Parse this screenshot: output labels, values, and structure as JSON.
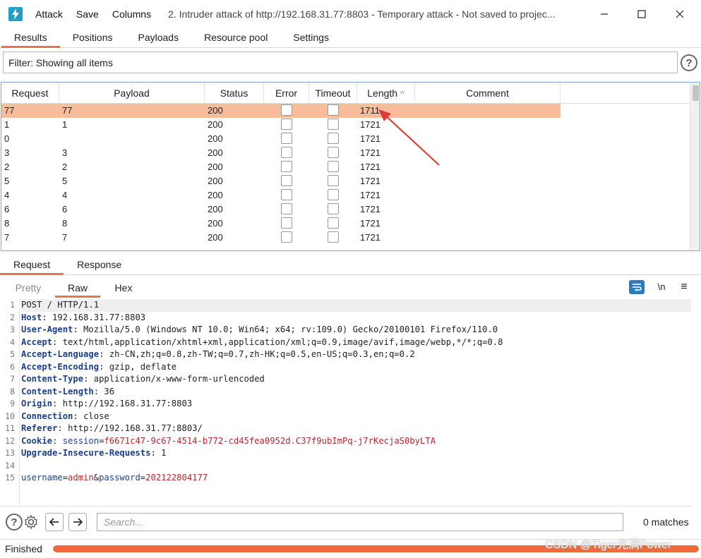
{
  "window": {
    "menu": [
      "Attack",
      "Save",
      "Columns"
    ],
    "title": "2. Intruder attack of http://192.168.31.77:8803 - Temporary attack - Not saved to projec...",
    "controls": {
      "minimize": "minimize-icon",
      "maximize": "maximize-icon",
      "close": "close-icon"
    }
  },
  "main_tabs": [
    {
      "label": "Results",
      "active": true
    },
    {
      "label": "Positions",
      "active": false
    },
    {
      "label": "Payloads",
      "active": false
    },
    {
      "label": "Resource pool",
      "active": false
    },
    {
      "label": "Settings",
      "active": false
    }
  ],
  "filter": {
    "label": "Filter: Showing all items"
  },
  "table": {
    "columns": [
      "Request",
      "Payload",
      "Status",
      "Error",
      "Timeout",
      "Length",
      "Comment"
    ],
    "sort": {
      "column": "Length",
      "direction": "ascending"
    },
    "rows": [
      {
        "request": "77",
        "payload": "77",
        "status": "200",
        "error": false,
        "timeout": false,
        "length": "1711",
        "comment": "",
        "selected": true
      },
      {
        "request": "1",
        "payload": "1",
        "status": "200",
        "error": false,
        "timeout": false,
        "length": "1721",
        "comment": ""
      },
      {
        "request": "0",
        "payload": "",
        "status": "200",
        "error": false,
        "timeout": false,
        "length": "1721",
        "comment": ""
      },
      {
        "request": "3",
        "payload": "3",
        "status": "200",
        "error": false,
        "timeout": false,
        "length": "1721",
        "comment": ""
      },
      {
        "request": "2",
        "payload": "2",
        "status": "200",
        "error": false,
        "timeout": false,
        "length": "1721",
        "comment": ""
      },
      {
        "request": "5",
        "payload": "5",
        "status": "200",
        "error": false,
        "timeout": false,
        "length": "1721",
        "comment": ""
      },
      {
        "request": "4",
        "payload": "4",
        "status": "200",
        "error": false,
        "timeout": false,
        "length": "1721",
        "comment": ""
      },
      {
        "request": "6",
        "payload": "6",
        "status": "200",
        "error": false,
        "timeout": false,
        "length": "1721",
        "comment": ""
      },
      {
        "request": "8",
        "payload": "8",
        "status": "200",
        "error": false,
        "timeout": false,
        "length": "1721",
        "comment": ""
      },
      {
        "request": "7",
        "payload": "7",
        "status": "200",
        "error": false,
        "timeout": false,
        "length": "1721",
        "comment": ""
      }
    ]
  },
  "rr_tabs": [
    {
      "label": "Request",
      "active": true
    },
    {
      "label": "Response",
      "active": false
    }
  ],
  "editor_tabs": [
    {
      "label": "Pretty",
      "active": false
    },
    {
      "label": "Raw",
      "active": true
    },
    {
      "label": "Hex",
      "active": false
    }
  ],
  "editor_tools": {
    "wrap": "wrap-lines-icon",
    "newline": "\\n",
    "menu": "hamburger-menu-icon"
  },
  "request_lines": [
    {
      "n": "1",
      "key": "",
      "sep": "",
      "value": "POST / HTTP/1.1"
    },
    {
      "n": "2",
      "key": "Host",
      "sep": ": ",
      "value": "192.168.31.77:8803"
    },
    {
      "n": "3",
      "key": "User-Agent",
      "sep": ": ",
      "value": "Mozilla/5.0 (Windows NT 10.0; Win64; x64; rv:109.0) Gecko/20100101 Firefox/110.0"
    },
    {
      "n": "4",
      "key": "Accept",
      "sep": ": ",
      "value": "text/html,application/xhtml+xml,application/xml;q=0.9,image/avif,image/webp,*/*;q=0.8"
    },
    {
      "n": "5",
      "key": "Accept-Language",
      "sep": ": ",
      "value": "zh-CN,zh;q=0.8,zh-TW;q=0.7,zh-HK;q=0.5,en-US;q=0.3,en;q=0.2"
    },
    {
      "n": "6",
      "key": "Accept-Encoding",
      "sep": ": ",
      "value": "gzip, deflate"
    },
    {
      "n": "7",
      "key": "Content-Type",
      "sep": ": ",
      "value": "application/x-www-form-urlencoded"
    },
    {
      "n": "8",
      "key": "Content-Length",
      "sep": ": ",
      "value": "36"
    },
    {
      "n": "9",
      "key": "Origin",
      "sep": ": ",
      "value": "http://192.168.31.77:8803"
    },
    {
      "n": "10",
      "key": "Connection",
      "sep": ": ",
      "value": "close"
    },
    {
      "n": "11",
      "key": "Referer",
      "sep": ": ",
      "value": "http://192.168.31.77:8803/"
    },
    {
      "n": "12",
      "key": "Cookie",
      "sep": ": ",
      "cookie_name": "session",
      "cookie_value": "f6671c47-9c67-4514-b772-cd45fea0952d.C37f9ubImPq-j7rKecjaS0byLTA"
    },
    {
      "n": "13",
      "key": "Upgrade-Insecure-Requests",
      "sep": ": ",
      "value": "1"
    },
    {
      "n": "14",
      "key": "",
      "sep": "",
      "value": ""
    },
    {
      "n": "15",
      "body": [
        {
          "name": "username",
          "value": "admin"
        },
        {
          "name": "password",
          "value": "202122804177"
        }
      ]
    }
  ],
  "search": {
    "placeholder": "Search...",
    "value": "",
    "matches": "0 matches"
  },
  "status": {
    "text": "Finished",
    "progress": 1.0
  },
  "watermark": "CSDN @Tiger充满Power",
  "colors": {
    "accent": "#e8744e",
    "selected_row": "#f9bc9a",
    "progress": "#f06b3a",
    "logo": "#1ea0c8",
    "header_key": "#1a3f8f",
    "value_red": "#b3282c",
    "annotation_arrow": "#e23a34"
  }
}
